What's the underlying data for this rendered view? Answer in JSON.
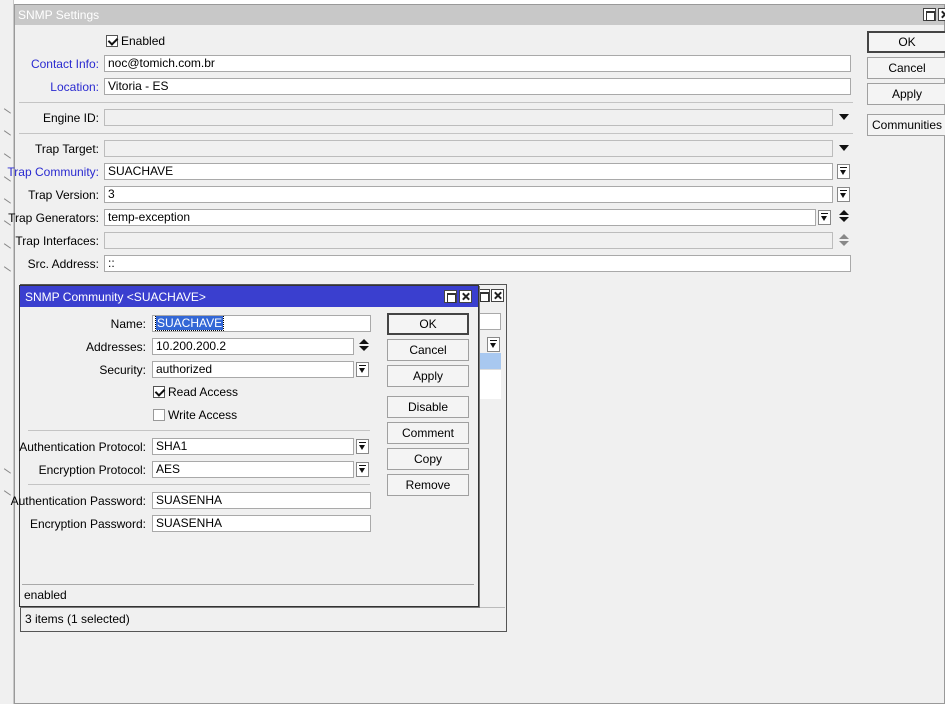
{
  "window": {
    "title": "SNMP Settings"
  },
  "settings": {
    "enabled_label": "Enabled",
    "enabled": true,
    "contact_info_label": "Contact Info:",
    "contact_info": "noc@tomich.com.br",
    "location_label": "Location:",
    "location": "Vitoria - ES",
    "engine_id_label": "Engine ID:",
    "engine_id": "",
    "trap_target_label": "Trap Target:",
    "trap_target": "",
    "trap_community_label": "Trap Community:",
    "trap_community": "SUACHAVE",
    "trap_version_label": "Trap Version:",
    "trap_version": "3",
    "trap_generators_label": "Trap Generators:",
    "trap_generators": "temp-exception",
    "trap_interfaces_label": "Trap Interfaces:",
    "trap_interfaces": "",
    "src_address_label": "Src. Address:",
    "src_address": "::"
  },
  "buttons": {
    "ok": "OK",
    "cancel": "Cancel",
    "apply": "Apply",
    "communities": "Communities"
  },
  "list_window": {
    "status": "3 items (1 selected)"
  },
  "dialog": {
    "title": "SNMP Community <SUACHAVE>",
    "name_label": "Name:",
    "name": "SUACHAVE",
    "addresses_label": "Addresses:",
    "addresses": "10.200.200.2",
    "security_label": "Security:",
    "security": "authorized",
    "read_access_label": "Read Access",
    "read_access": true,
    "write_access_label": "Write Access",
    "write_access": false,
    "auth_protocol_label": "Authentication Protocol:",
    "auth_protocol": "SHA1",
    "enc_protocol_label": "Encryption Protocol:",
    "enc_protocol": "AES",
    "auth_password_label": "Authentication Password:",
    "auth_password": "SUASENHA",
    "enc_password_label": "Encryption Password:",
    "enc_password": "SUASENHA",
    "status": "enabled",
    "buttons": {
      "ok": "OK",
      "cancel": "Cancel",
      "apply": "Apply",
      "disable": "Disable",
      "comment": "Comment",
      "copy": "Copy",
      "remove": "Remove"
    }
  }
}
